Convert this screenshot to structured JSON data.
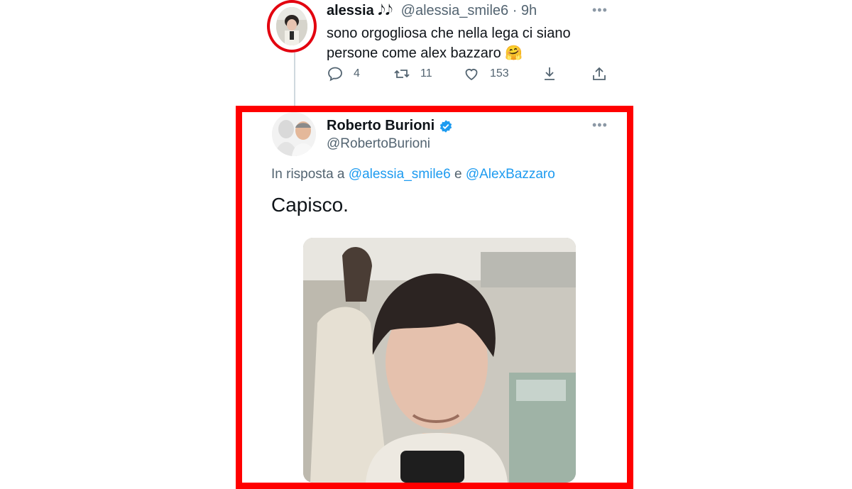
{
  "tweet1": {
    "name": "alessia",
    "name_emoji": "𝅘𝅥𝅮𝅘𝅥𝅮",
    "handle_time": "@alessia_smile6 · 9h",
    "more": "•••",
    "text_line1": "sono orgogliosa che nella lega ci siano",
    "text_line2": "persone come alex bazzaro",
    "text_emoji": "🤗",
    "replies": "4",
    "retweets": "11",
    "likes": "153"
  },
  "tweet2": {
    "name": "Roberto Burioni",
    "handle": "@RobertoBurioni",
    "more": "•••",
    "reply_prefix": "In risposta a",
    "mention1": "@alessia_smile6",
    "conj": "e",
    "mention2": "@AlexBazzaro",
    "text": "Capisco."
  },
  "colors": {
    "highlight_red": "#ff0000",
    "verified_blue": "#1d9bf0",
    "muted_text": "#536471"
  },
  "icons": [
    "reply-icon",
    "retweet-icon",
    "like-icon",
    "share-icon",
    "upload-icon",
    "verified-badge-icon",
    "more-icon"
  ]
}
